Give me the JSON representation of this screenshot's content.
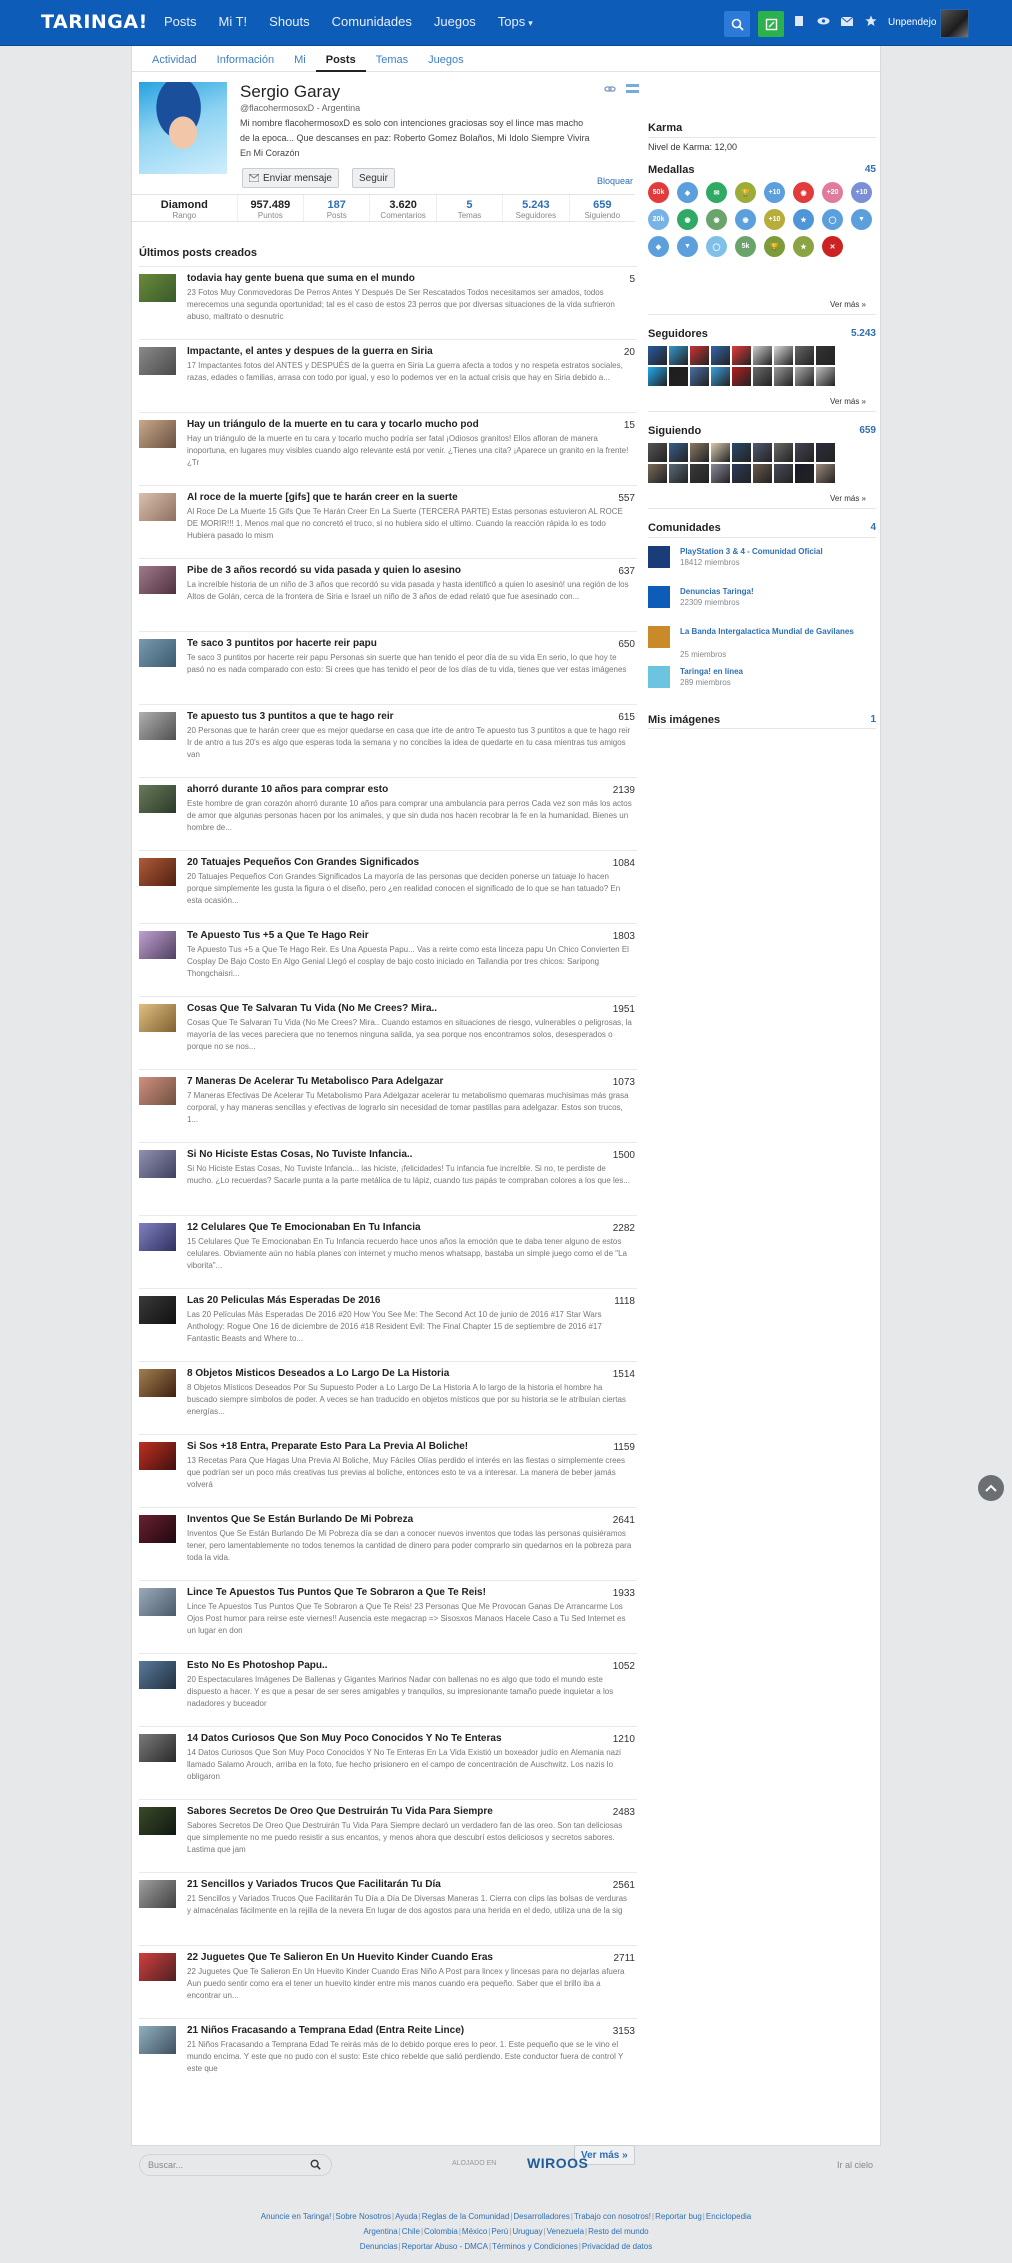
{
  "topbar": {
    "logo": "TARINGA!",
    "nav": [
      "Posts",
      "Mi T!",
      "Shouts",
      "Comunidades",
      "Juegos",
      "Tops"
    ],
    "username": "Unpendejo",
    "colors": {
      "bar": "#0d5cb8",
      "search": "#2d7ad8",
      "post": "#2bb24c"
    }
  },
  "subnav": [
    "Actividad",
    "Información",
    "Mi",
    "Posts",
    "Temas",
    "Juegos"
  ],
  "profile": {
    "name": "Sergio Garay",
    "user_line": "@flacohermosoxD - Argentina",
    "bio": "Mi nombre flacohermosoxD es solo con intenciones graciosas soy el lince mas macho de la epoca... Que descanses en paz: Roberto Gomez Bolaños, Mi Idolo Siempre Vivira En Mi Corazón",
    "send_message": "Enviar mensaje",
    "follow": "Seguir",
    "block": "Bloquear"
  },
  "stats": [
    {
      "value": "Diamond",
      "label": "Rango",
      "blue": false
    },
    {
      "value": "957.489",
      "label": "Puntos",
      "blue": false
    },
    {
      "value": "187",
      "label": "Posts",
      "blue": true
    },
    {
      "value": "3.620",
      "label": "Comentarios",
      "blue": false
    },
    {
      "value": "5",
      "label": "Temas",
      "blue": true
    },
    {
      "value": "5.243",
      "label": "Seguidores",
      "blue": true
    },
    {
      "value": "659",
      "label": "Siguiendo",
      "blue": true
    }
  ],
  "posts_section": {
    "title": "Últimos posts creados",
    "more": "Ver más »",
    "items": [
      {
        "title": "todavia hay gente buena que suma en el mundo",
        "score": "5",
        "desc": "23 Fotos Muy Conmovedoras De Perros Antes Y Después De Ser Rescatados Todos necesitamos ser amados, todos merecemos una segunda oportunidad; tal es el caso de estos 23 perros que por diversas situaciones de la vida sufrieron abuso, maltrato o desnutric"
      },
      {
        "title": "Impactante, el antes y despues de la guerra en Siria",
        "score": "20",
        "desc": "17 Impactantes fotos del ANTES y DESPUÉS de la guerra en Siria La guerra afecta a todos y no respeta estratos sociales, razas, edades o familias, arrasa con todo por igual, y eso lo podemos ver en la actual crisis que hay en Siria debido a..."
      },
      {
        "title": "Hay un triángulo de la muerte en tu cara y tocarlo mucho pod",
        "score": "15",
        "desc": "Hay un triángulo de la muerte en tu cara y tocarlo mucho podría ser fatal ¡Odiosos granitos! Ellos afloran de manera inoportuna, en lugares muy visibles cuando algo relevante está por venir. ¿Tienes una cita? ¡Aparece un granito en la frente! ¿Tr"
      },
      {
        "title": "Al roce de la muerte [gifs] que te harán creer en la suerte",
        "score": "557",
        "desc": "Al Roce De La Muerte 15 Gifs Que Te Harán Creer En La Suerte (TERCERA PARTE) Estas personas estuvieron AL ROCE DE MORIR!!! 1. Menos mal que no concretó el truco, si no hubiera sido el ultimo. Cuando la reacción rápida lo es todo Hubiera pasado lo mism"
      },
      {
        "title": "Pibe de 3 años recordó su vida pasada y quien lo asesino",
        "score": "637",
        "desc": "La increíble historia de un niño de 3 años que recordó su vida pasada y hasta identificó a quien lo asesinó! una región de los Altos de Golán, cerca de la frontera de Siria e Israel un niño de 3 años de edad relató que fue asesinado con..."
      },
      {
        "title": "Te saco 3 puntitos por hacerte reir papu",
        "score": "650",
        "desc": "Te saco 3 puntitos por hacerte reir papu Personas sin suerte que han tenido el peor día de su vida En serio, lo que hoy te pasó no es nada comparado con esto: Si crees que has tenido el peor de los días de tu vida, tienes que ver estas imágenes"
      },
      {
        "title": "Te apuesto tus 3 puntitos a que te hago reir",
        "score": "615",
        "desc": "20 Personas que te harán creer que es mejor quedarse en casa que irte de antro Te apuesto tus 3 puntitos a que te hago reir Ir de antro a tus 20's es algo que esperas toda la semana y no concibes la idea de quedarte en tu casa mientras tus amigos van"
      },
      {
        "title": "ahorró durante 10 años para comprar esto",
        "score": "2139",
        "desc": "Este hombre de gran corazón ahorró durante 10 años para comprar una ambulancia para perros Cada vez son más los actos de amor que algunas personas hacen por los animales, y que sin duda nos hacen recobrar la fe en la humanidad. Bienes un hombre de..."
      },
      {
        "title": "20 Tatuajes Pequeños Con Grandes Significados",
        "score": "1084",
        "desc": "20 Tatuajes Pequeños Con Grandes Significados La mayoría de las personas que deciden ponerse un tatuaje lo hacen porque simplemente les gusta la figura o el diseño, pero ¿en realidad conocen el significado de lo que se han tatuado? En esta ocasión..."
      },
      {
        "title": "Te Apuesto Tus +5 a Que Te Hago Reir",
        "score": "1803",
        "desc": "Te Apuesto Tus +5 a Que Te Hago Reir. Es Una Apuesta Papu... Vas a reirte como esta linceza papu Un Chico Convierten El Cosplay De Bajo Costo En Algo Genial Llegó el cosplay de bajo costo iniciado en Tailandia por tres chicos: Saripong Thongchaisri..."
      },
      {
        "title": "Cosas Que Te Salvaran Tu Vida (No Me Crees? Mira..",
        "score": "1951",
        "desc": "Cosas Que Te Salvaran Tu Vida (No Me Crees? Mira.. Cuando estamos en situaciones de riesgo, vulnerables o peligrosas, la mayoría de las veces pareciera que no tenemos ninguna salida, ya sea porque nos encontramos solos, desesperados o porque no se nos..."
      },
      {
        "title": "7 Maneras De Acelerar Tu Metabolisco Para Adelgazar",
        "score": "1073",
        "desc": "7 Maneras Efectivas De Acelerar Tu Metabolismo Para Adelgazar acelerar tu metabolismo quemaras muchisimas más grasa corporal, y hay maneras sencillas y efectivas de lograrlo sin necesidad de tomar pastillas para adelgazar. Estos son trucos, 1..."
      },
      {
        "title": "Si No Hiciste Estas Cosas, No Tuviste Infancia..",
        "score": "1500",
        "desc": "Si No Hiciste Estas Cosas, No Tuviste Infancia... las hiciste, ¡felicidades! Tu infancia fue increíble. Si no, te perdiste de mucho. ¿Lo recuerdas? Sacarle punta a la parte metálica de tu lápiz, cuando tus papás te compraban colores a los que les..."
      },
      {
        "title": "12 Celulares Que Te Emocionaban En Tu Infancia",
        "score": "2282",
        "desc": "15 Celulares Que Te Emocionaban En Tu Infancia recuerdo hace unos años la emoción que te daba tener alguno de estos celulares. Obviamente aún no había planes con internet y mucho menos whatsapp, bastaba un simple juego como el de \"La viborita\"..."
      },
      {
        "title": "Las 20 Peliculas Más Esperadas De 2016",
        "score": "1118",
        "desc": "Las 20 Películas Más Esperadas De 2016 #20 How You See Me: The Second Act 10 de junio de 2016 #17 Star Wars Anthology: Rogue One 16 de diciembre de 2016 #18 Resident Evil: The Final Chapter 15 de septiembre de 2016 #17 Fantastic Beasts and Where to..."
      },
      {
        "title": "8 Objetos Misticos Deseados a Lo Largo De La Historia",
        "score": "1514",
        "desc": "8 Objetos Místicos Deseados Por Su Supuesto Poder a Lo Largo De La Historia A lo largo de la historia el hombre ha buscado siempre símbolos de poder. A veces se han traducido en objetos místicos que por su historia se le atribuían ciertas energías..."
      },
      {
        "title": "Si Sos +18 Entra, Preparate Esto Para La Previa Al Boliche!",
        "score": "1159",
        "desc": "13 Recetas Para Que Hagas Una Previa Al Boliche, Muy Fáciles Olías perdido el interés en las fiestas o simplemente crees que podrían ser un poco más creativas tus previas al boliche, entonces esto te va a interesar. La manera de beber jamás volverá"
      },
      {
        "title": "Inventos Que Se Están Burlando De Mi Pobreza",
        "score": "2641",
        "desc": "Inventos Que Se Están Burlando De Mi Pobreza día se dan a conocer nuevos inventos que todas las personas quisiéramos tener, pero lamentablemente no todos tenemos la cantidad de dinero para poder comprarlo sin quedarnos en la pobreza para toda la vida."
      },
      {
        "title": "Lince Te Apuestos Tus Puntos Que Te Sobraron a Que Te Reis!",
        "score": "1933",
        "desc": "Lince Te Apuestos Tus Puntos Que Te Sobraron a Que Te Reis! 23 Personas Que Me Provocan Ganas De Arrancarme Los Ojos Post humor para reirse este viernes!! Ausencia este megacrap => Sisosxos Manaos Hacele Caso a Tu Sed Internet es un lugar en don"
      },
      {
        "title": "Esto No Es Photoshop Papu..",
        "score": "1052",
        "desc": "20 Espectaculares Imágenes De Ballenas y Gigantes Marinos Nadar con ballenas no es algo que todo el mundo este dispuesto a hacer. Y es que a pesar de ser seres amigables y tranquilos, su impresionante tamaño puede inquietar a los nadadores y buceador"
      },
      {
        "title": "14 Datos Curiosos Que Son Muy Poco Conocidos Y No Te Enteras",
        "score": "1210",
        "desc": "14 Datos Curiosos Que Son Muy Poco Conocidos Y No Te Enteras En La Vida Existió un boxeador judío en Alemania nazi llamado Salamo Arouch, arriba en la foto, fue hecho prisionero en el campo de concentración de Auschwitz. Los nazis lo obligaron"
      },
      {
        "title": "Sabores Secretos De Oreo Que Destruirán Tu Vida Para Siempre",
        "score": "2483",
        "desc": "Sabores Secretos De Oreo Que Destruirán Tu Vida Para Siempre declaró un verdadero fan de las oreo. Son tan deliciosas que simplemente no me puedo resistir a sus encantos, y menos ahora que descubrí estos deliciosos y secretos sabores. Lastima que jam"
      },
      {
        "title": "21 Sencillos y Variados Trucos Que Facilitarán Tu Día",
        "score": "2561",
        "desc": "21 Sencillos y Variados Trucos Que Facilitarán Tu Día a Día De Diversas Maneras 1. Cierra con clips las bolsas de verduras y almacénalas fácilmente en la rejilla de la nevera En lugar de dos agostos para una herida en el dedo, utiliza una de la sig"
      },
      {
        "title": "22 Juguetes Que Te Salieron En Un Huevito Kinder Cuando Eras",
        "score": "2711",
        "desc": "22 Juguetes Que Te Salieron En Un Huevito Kinder Cuando Eras Niño A Post para lincex y lincesas para no dejarlas afuera Aun puedo sentir como era el tener un huevito kinder entre mis manos cuando era pequeño. Saber que el brillo iba a encontrar un..."
      },
      {
        "title": "21 Niños Fracasando a Temprana Edad (Entra Reite Lince)",
        "score": "3153",
        "desc": "21 Niños Fracasando a Temprana Edad Te reirás más de lo debido porque eres lo peor. 1. Este pequeño que se le vino el mundo encima. Y este que no pudo con el susto: Este chico rebelde que salió perdiendo. Este conductor fuera de control Y este que"
      }
    ]
  },
  "sidebar": {
    "karma": {
      "title": "Karma",
      "text": "Nivel de Karma: 12,00"
    },
    "medals": {
      "title": "Medallas",
      "count": "45",
      "more": "Ver más »",
      "items": [
        {
          "label": "50k",
          "color": "#e23b3b"
        },
        {
          "label": "◆",
          "color": "#5b9fdd"
        },
        {
          "label": "✉",
          "color": "#2faa65"
        },
        {
          "label": "🏆",
          "color": "#9cac39"
        },
        {
          "label": "+10",
          "color": "#5b9fdd"
        },
        {
          "label": "◉",
          "color": "#e23b3b"
        },
        {
          "label": "+20",
          "color": "#e07b9b"
        },
        {
          "label": "+10",
          "color": "#7a8fd6"
        },
        {
          "label": "20k",
          "color": "#79b3e6"
        },
        {
          "label": "◉",
          "color": "#2faa65"
        },
        {
          "label": "◉",
          "color": "#6aa46a"
        },
        {
          "label": "◉",
          "color": "#5b9fdd"
        },
        {
          "label": "+10",
          "color": "#b7ad3c"
        },
        {
          "label": "★",
          "color": "#4f96d8"
        },
        {
          "label": "◯",
          "color": "#5b9fdd"
        },
        {
          "label": "▼",
          "color": "#5b9fdd"
        },
        {
          "label": "◆",
          "color": "#5b9fdd"
        },
        {
          "label": "▼",
          "color": "#5b9fdd"
        },
        {
          "label": "◯",
          "color": "#7fbfe8"
        },
        {
          "label": "5k",
          "color": "#6aa46a"
        },
        {
          "label": "🏆",
          "color": "#7d9b3a"
        },
        {
          "label": "★",
          "color": "#8ba443"
        },
        {
          "label": "✕",
          "color": "#cc2222"
        }
      ]
    },
    "followers": {
      "title": "Seguidores",
      "count": "5.243",
      "more": "Ver más »",
      "colors": [
        "#2a5aa0",
        "#3399cc",
        "#cc3333",
        "#3366aa",
        "#e23b3b",
        "#cccccc",
        "#d9d9d9",
        "#666666",
        "#333333",
        "#22aaee",
        "#1e1e1e",
        "#4a6fa5",
        "#3aa0dd",
        "#b51f1f",
        "#6b6b6b",
        "#999999",
        "#aaaaaa",
        "#c0c0c0"
      ]
    },
    "following": {
      "title": "Siguiendo",
      "count": "659",
      "more": "Ver más »",
      "colors": [
        "#555555",
        "#3a5f8a",
        "#8a7a66",
        "#d9c9b0",
        "#2a4a6a",
        "#505a70",
        "#6a6a6a",
        "#444455",
        "#2d2d3d",
        "#7a6a5a",
        "#5a6a7a",
        "#3a3a3a",
        "#8a8a9a",
        "#2a3a5a",
        "#6a5a4a",
        "#4a4a5a",
        "#1a1a2a",
        "#9a8a7a"
      ]
    },
    "communities": {
      "title": "Comunidades",
      "count": "4",
      "items": [
        {
          "name": "PlayStation 3 & 4 - Comunidad Oficial",
          "members": "18412 miembros",
          "color": "#1a3d7a"
        },
        {
          "name": "Denuncias Taringa!",
          "members": "22309 miembros",
          "color": "#0d5cb8"
        },
        {
          "name": "La Banda Intergalactica Mundial de Gavilanes",
          "members": "25 miembros",
          "color": "#c98a2a"
        },
        {
          "name": "Taringa! en línea",
          "members": "289 miembros",
          "color": "#6cc4e0"
        }
      ]
    },
    "images": {
      "title": "Mis imágenes",
      "count": "1"
    }
  },
  "footer": {
    "search_placeholder": "Buscar...",
    "powered": "ALOJADO EN",
    "wiroos": "WIROOS",
    "top": "Ir al cielo",
    "row1": [
      "Anuncie en Taringa!",
      "Sobre Nosotros",
      "Ayuda",
      "Reglas de la Comunidad",
      "Desarrolladores",
      "Trabajo con nosotros!",
      "Reportar bug",
      "Enciclopedia"
    ],
    "row2": [
      "Argentina",
      "Chile",
      "Colombia",
      "México",
      "Perú",
      "Uruguay",
      "Venezuela",
      "Resto del mundo"
    ],
    "row3": [
      "Denuncias",
      "Reportar Abuso - DMCA",
      "Términos y Condiciones",
      "Privacidad de datos"
    ]
  }
}
